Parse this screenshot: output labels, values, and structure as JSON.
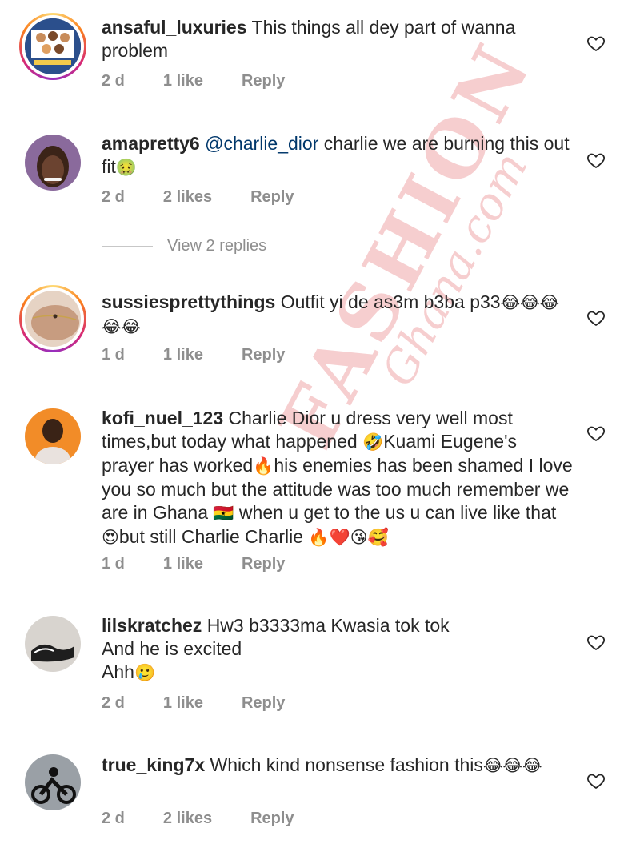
{
  "watermark": {
    "main": "FASHION",
    "sub": "Ghana.com"
  },
  "view_replies_label": "View 2 replies",
  "comments": [
    {
      "username": "ansaful_luxuries",
      "text": "This things all dey part of wanna problem",
      "mention": "",
      "emojis": "",
      "time": "2 d",
      "likes": "1 like",
      "reply": "Reply",
      "story_ring": true
    },
    {
      "username": "amapretty6",
      "mention": "@charlie_dior",
      "text": "charlie we are burning this out fit",
      "emojis": "🤢",
      "time": "2 d",
      "likes": "2 likes",
      "reply": "Reply",
      "story_ring": false
    },
    {
      "username": "sussiesprettythings",
      "text": "Outfit yi de as3m b3ba p33",
      "mention": "",
      "emojis": "😂😂😂😂😂",
      "time": "1 d",
      "likes": "1 like",
      "reply": "Reply",
      "story_ring": true
    },
    {
      "username": "kofi_nuel_123",
      "mention": "",
      "text_parts": [
        "Charlie Dior u dress very well most times,but today what happened ",
        "🤣",
        "Kuami Eugene's prayer has worked",
        "🔥",
        "his enemies has been shamed I love you so much but the attitude was too much remember we are in Ghana ",
        "🇬🇭",
        " when u get to the us u can live like that ",
        "😍",
        "but still Charlie Charlie ",
        "🔥❤️😘🥰"
      ],
      "time": "1 d",
      "likes": "1 like",
      "reply": "Reply",
      "story_ring": false
    },
    {
      "username": "lilskratchez",
      "text_lines": [
        "Hw3 b3333ma Kwasia tok tok",
        "And he is excited",
        "Ahh"
      ],
      "emojis": "🥲",
      "time": "2 d",
      "likes": "1 like",
      "reply": "Reply",
      "story_ring": false
    },
    {
      "username": "true_king7x",
      "text": "Which kind nonsense fashion this",
      "emojis": "😂😂😂",
      "time": "2 d",
      "likes": "2 likes",
      "reply": "Reply",
      "story_ring": false
    }
  ]
}
